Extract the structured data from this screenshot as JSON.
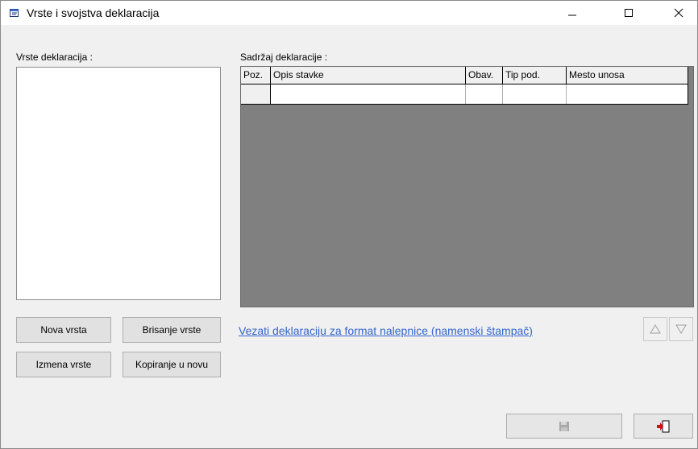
{
  "window": {
    "title": "Vrste i svojstva deklaracija"
  },
  "titlebar_buttons": {
    "minimize": "minimize-icon",
    "maximize": "maximize-icon",
    "close": "close-icon"
  },
  "left_panel": {
    "label": "Vrste deklaracija :",
    "items": [],
    "buttons": {
      "new": "Nova vrsta",
      "delete": "Brisanje vrste",
      "edit": "Izmena vrste",
      "copy": "Kopiranje u novu"
    }
  },
  "right_panel": {
    "label": "Sadržaj deklaracije :",
    "columns": [
      "Poz.",
      "Opis stavke",
      "Obav.",
      "Tip pod.",
      "Mesto unosa"
    ],
    "rows": [
      [
        "",
        "",
        "",
        "",
        ""
      ]
    ]
  },
  "link_text": "Vezati deklaraciju za format nalepnice (namenski štampač)",
  "icons": {
    "move_up": "triangle-up-icon",
    "move_down": "triangle-down-icon",
    "save": "floppy-disk-icon",
    "exit": "exit-door-icon"
  }
}
